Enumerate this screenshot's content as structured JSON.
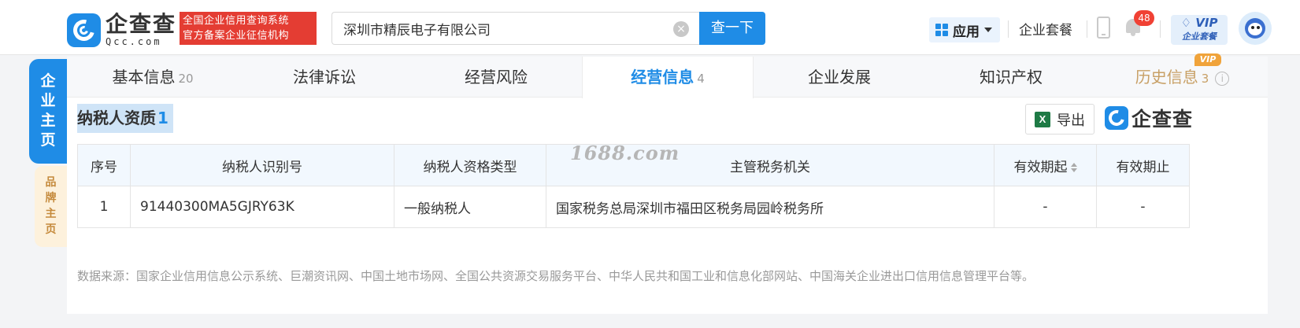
{
  "header": {
    "logo_cn": "企查查",
    "logo_en": "Qcc.com",
    "slogan_line1": "全国企业信用查询系统",
    "slogan_line2": "官方备案企业征信机构",
    "search_value": "深圳市精辰电子有限公司",
    "search_button": "查一下",
    "apps_label": "应用",
    "package_label": "企业套餐",
    "notification_count": "48",
    "vip_label": "VIP",
    "vip_sub": "企业套餐"
  },
  "side": {
    "main_label": "企业主页",
    "brand_label": "品牌主页"
  },
  "tabs": [
    {
      "label": "基本信息",
      "count": "20"
    },
    {
      "label": "法律诉讼",
      "count": ""
    },
    {
      "label": "经营风险",
      "count": ""
    },
    {
      "label": "经营信息",
      "count": "4"
    },
    {
      "label": "企业发展",
      "count": ""
    },
    {
      "label": "知识产权",
      "count": ""
    },
    {
      "label": "历史信息",
      "count": "3"
    }
  ],
  "history_vip_tag": "VIP",
  "section": {
    "title": "纳税人资质",
    "count": "1",
    "export_label": "导出",
    "brand": "企查查",
    "watermark": "1688.com"
  },
  "table": {
    "columns": [
      "序号",
      "纳税人识别号",
      "纳税人资格类型",
      "主管税务机关",
      "有效期起",
      "有效期止"
    ],
    "rows": [
      [
        "1",
        "91440300MA5GJRY63K",
        "一般纳税人",
        "国家税务总局深圳市福田区税务局园岭税务所",
        "-",
        "-"
      ]
    ]
  },
  "source_text": "数据来源：国家企业信用信息公示系统、巨潮资讯网、中国土地市场网、全国公共资源交易服务平台、中华人民共和国工业和信息化部网站、中国海关企业进出口信用信息管理平台等。",
  "colors": {
    "accent": "#1f8ce6",
    "slogan_bg": "#e43d33",
    "history_gold": "#c8a066",
    "badge_red": "#f04134"
  }
}
